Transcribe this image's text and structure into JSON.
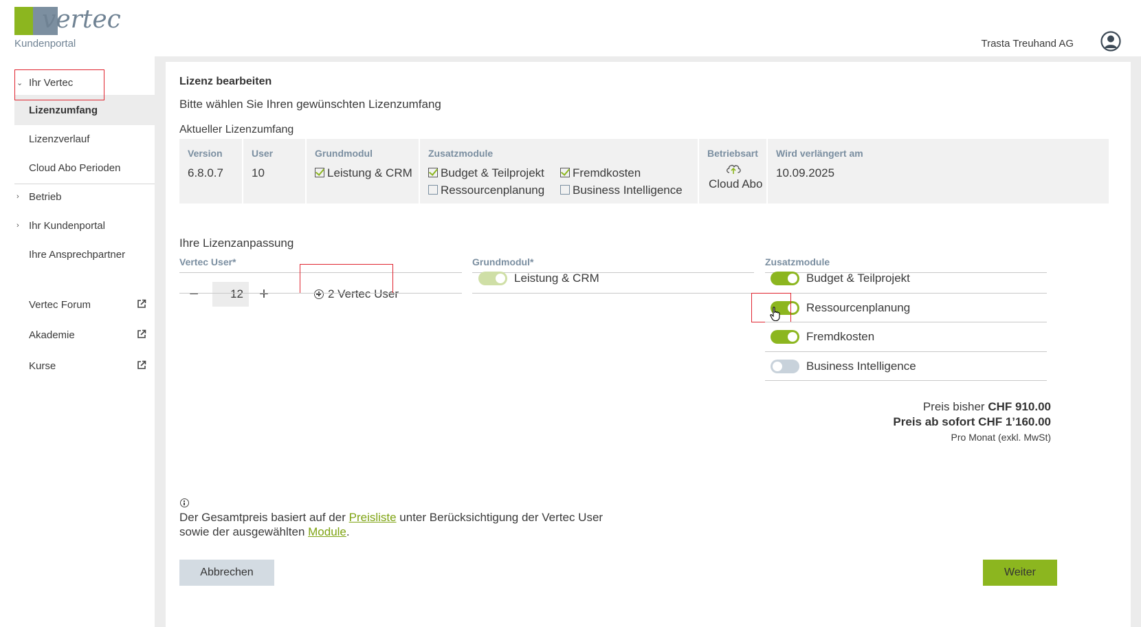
{
  "header": {
    "logo_word": "vertec",
    "logo_sub": "Kundenportal",
    "company": "Trasta Treuhand AG",
    "avatar_icon": "user-circle-icon"
  },
  "sidebar": {
    "group_ihr_vertec": "Ihr Vertec",
    "items": [
      {
        "label": "Lizenzumfang"
      },
      {
        "label": "Lizenzverlauf"
      },
      {
        "label": "Cloud Abo Perioden"
      },
      {
        "label": "Betrieb"
      },
      {
        "label": "Ihr Kundenportal"
      },
      {
        "label": "Ihre Ansprechpartner"
      },
      {
        "label": "Vertec Forum"
      },
      {
        "label": "Akademie"
      },
      {
        "label": "Kurse"
      }
    ]
  },
  "page": {
    "title": "Lizenz bearbeiten",
    "subtitle": "Bitte wählen Sie Ihren gewünschten Lizenzumfang",
    "current_section": "Aktueller Lizenzumfang"
  },
  "current": {
    "version_label": "Version",
    "version": "6.8.0.7",
    "user_label": "User",
    "user": "10",
    "grundmodul_label": "Grundmodul",
    "grundmodul": "Leistung & CRM",
    "zusatz_label": "Zusatzmodule",
    "zusatz": [
      {
        "name": "Budget & Teilprojekt",
        "checked": true
      },
      {
        "name": "Fremdkosten",
        "checked": true
      },
      {
        "name": "Ressourcenplanung",
        "checked": false
      },
      {
        "name": "Business Intelligence",
        "checked": false
      }
    ],
    "betriebsart_label": "Betriebsart",
    "betriebsart": "Cloud Abo",
    "verlaengert_label": "Wird verlängert am",
    "verlaengert": "10.09.2025"
  },
  "adjust": {
    "title": "Ihre Lizenzanpassung",
    "col_user": "Vertec User*",
    "col_grund": "Grundmodul*",
    "col_zusatz": "Zusatzmodule",
    "user_count": "12",
    "add_users": "2 Vertec User",
    "grundmodul": "Leistung & CRM",
    "toggles": [
      {
        "name": "Budget & Teilprojekt",
        "on": true
      },
      {
        "name": "Ressourcenplanung",
        "on": true
      },
      {
        "name": "Fremdkosten",
        "on": true
      },
      {
        "name": "Business Intelligence",
        "on": false
      }
    ]
  },
  "price": {
    "prev_label": "Preis bisher",
    "prev_value": "CHF 910.00",
    "new_label": "Preis ab sofort CHF 1’160.00",
    "note": "Pro Monat (exkl. MwSt)"
  },
  "info": {
    "line1_a": "Der Gesamtpreis basiert auf der ",
    "link1": "Preisliste",
    "line1_b": " unter Berücksichtigung der Vertec User",
    "line2_a": "sowie der ausgewählten ",
    "link2": "Module",
    "line2_b": "."
  },
  "buttons": {
    "cancel": "Abbrechen",
    "next": "Weiter"
  },
  "colors": {
    "accent_green": "#8cb61f",
    "label_blue_gray": "#7a8ea0",
    "highlight_red": "#e0232e"
  }
}
